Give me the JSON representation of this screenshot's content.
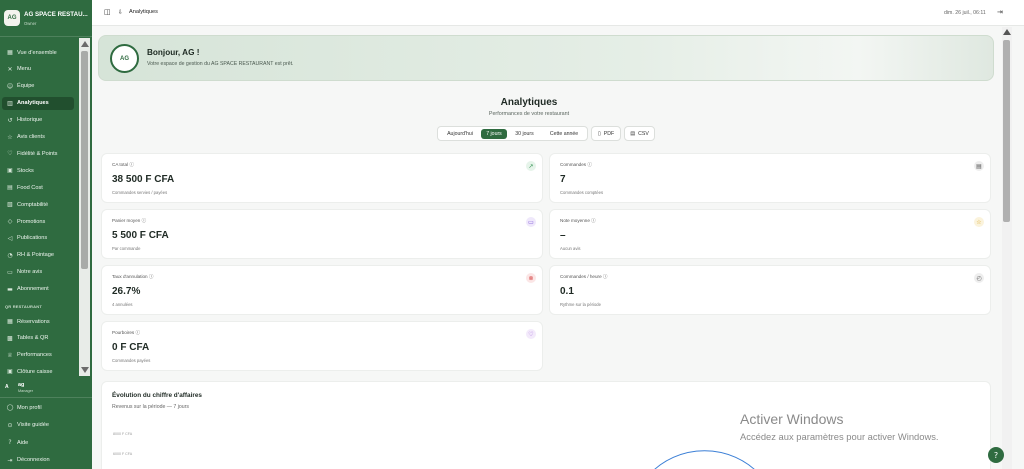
{
  "brand": {
    "name": "AG SPACE RESTAU...",
    "subtitle": "Owner",
    "logo_text": "AG"
  },
  "sidebar": {
    "items": [
      {
        "label": "Vue d'ensemble",
        "icon": "grid-icon",
        "glyph": "▦"
      },
      {
        "label": "Menu",
        "icon": "utensils-icon",
        "glyph": "✕"
      },
      {
        "label": "Équipe",
        "icon": "users-icon",
        "glyph": "☺"
      },
      {
        "label": "Analytiques",
        "icon": "bar-chart-icon",
        "glyph": "▥",
        "active": true
      },
      {
        "label": "Historique",
        "icon": "history-icon",
        "glyph": "↺"
      },
      {
        "label": "Avis clients",
        "icon": "star-icon",
        "glyph": "☆"
      },
      {
        "label": "Fidélité & Points",
        "icon": "gift-icon",
        "glyph": "♡"
      },
      {
        "label": "Stocks",
        "icon": "box-icon",
        "glyph": "▣"
      },
      {
        "label": "Food Cost",
        "icon": "calculator-icon",
        "glyph": "▤"
      },
      {
        "label": "Comptabilité",
        "icon": "ledger-icon",
        "glyph": "▧"
      },
      {
        "label": "Promotions",
        "icon": "tag-icon",
        "glyph": "◇"
      },
      {
        "label": "Publications",
        "icon": "megaphone-icon",
        "glyph": "◁"
      },
      {
        "label": "RH & Pointage",
        "icon": "clock-users-icon",
        "glyph": "◔"
      },
      {
        "label": "Notre avis",
        "icon": "message-icon",
        "glyph": "▭"
      },
      {
        "label": "Abonnement",
        "icon": "credit-card-icon",
        "glyph": "▬"
      }
    ],
    "section_title": "QR RESTAURANT",
    "section_items": [
      {
        "label": "Réservations",
        "icon": "calendar-icon",
        "glyph": "▦"
      },
      {
        "label": "Tables & QR",
        "icon": "qr-icon",
        "glyph": "▩"
      },
      {
        "label": "Performances",
        "icon": "trophy-icon",
        "glyph": "♕"
      },
      {
        "label": "Clôture caisse",
        "icon": "register-icon",
        "glyph": "▣"
      }
    ],
    "user": {
      "name": "ag",
      "role": "Manager",
      "initial": "A"
    },
    "bottom_items": [
      {
        "label": "Mon profil",
        "icon": "user-icon",
        "glyph": "◯"
      },
      {
        "label": "Visite guidée",
        "icon": "compass-icon",
        "glyph": "⊙"
      },
      {
        "label": "Aide",
        "icon": "help-icon",
        "glyph": "?"
      },
      {
        "label": "Déconnexion",
        "icon": "logout-icon",
        "glyph": "⇥"
      }
    ]
  },
  "topbar": {
    "title": "Analytiques",
    "date": "dim. 26 juil., 06:11"
  },
  "banner": {
    "greeting": "Bonjour, AG !",
    "message": "Votre espace de gestion du AG SPACE RESTAURANT est prêt.",
    "logo_text": "AG"
  },
  "header": {
    "title": "Analytiques",
    "subtitle": "Performances de votre restaurant"
  },
  "ranges": [
    {
      "label": "Aujourd'hui",
      "active": false
    },
    {
      "label": "7 jours",
      "active": true
    },
    {
      "label": "30 jours",
      "active": false
    },
    {
      "label": "Cette année",
      "active": false
    }
  ],
  "exports": {
    "pdf": "PDF",
    "csv": "CSV"
  },
  "metrics": [
    {
      "label": "CA total ⓘ",
      "value": "38 500 F CFA",
      "sub": "Commandes servies / payées",
      "icon": "trend-up-icon",
      "glyph": "↗",
      "color": "#2f8f4e",
      "bg": "#e6f4ea"
    },
    {
      "label": "Commandes ⓘ",
      "value": "7",
      "sub": "Commandes comptées",
      "icon": "receipt-icon",
      "glyph": "▤",
      "color": "#555555",
      "bg": "#eeeeee"
    },
    {
      "label": "Panier moyen ⓘ",
      "value": "5 500 F CFA",
      "sub": "Par commande",
      "icon": "cart-icon",
      "glyph": "▭",
      "color": "#7b4fd6",
      "bg": "#efe8fb"
    },
    {
      "label": "Note moyenne ⓘ",
      "value": "–",
      "sub": "Aucun avis",
      "icon": "star-icon",
      "glyph": "☆",
      "color": "#d6a21b",
      "bg": "#fbf3dc"
    },
    {
      "label": "Taux d'annulation ⓘ",
      "value": "26.7%",
      "sub": "4 annulées",
      "icon": "x-circle-icon",
      "glyph": "⊗",
      "color": "#d64545",
      "bg": "#fbe6e6"
    },
    {
      "label": "Commandes / heure ⓘ",
      "value": "0.1",
      "sub": "Rythme sur la période",
      "icon": "clock-icon",
      "glyph": "◴",
      "color": "#666666",
      "bg": "#eeeeee"
    },
    {
      "label": "Pourboires ⓘ",
      "value": "0 F CFA",
      "sub": "Commandes payées",
      "icon": "heart-icon",
      "glyph": "♡",
      "color": "#9b59d6",
      "bg": "#f3eafb"
    }
  ],
  "revenue_chart": {
    "title": "Évolution du chiffre d'affaires",
    "subtitle": "Revenus sur la période — 7 jours",
    "ticks": [
      "8000 F CFA",
      "6000 F CFA"
    ]
  },
  "watermark": {
    "title": "Activer Windows",
    "sub": "Accédez aux paramètres pour activer Windows."
  },
  "colors": {
    "brand_green": "#2f6b40",
    "active_nav": "#214f2e",
    "line_blue": "#3b7fd6"
  }
}
